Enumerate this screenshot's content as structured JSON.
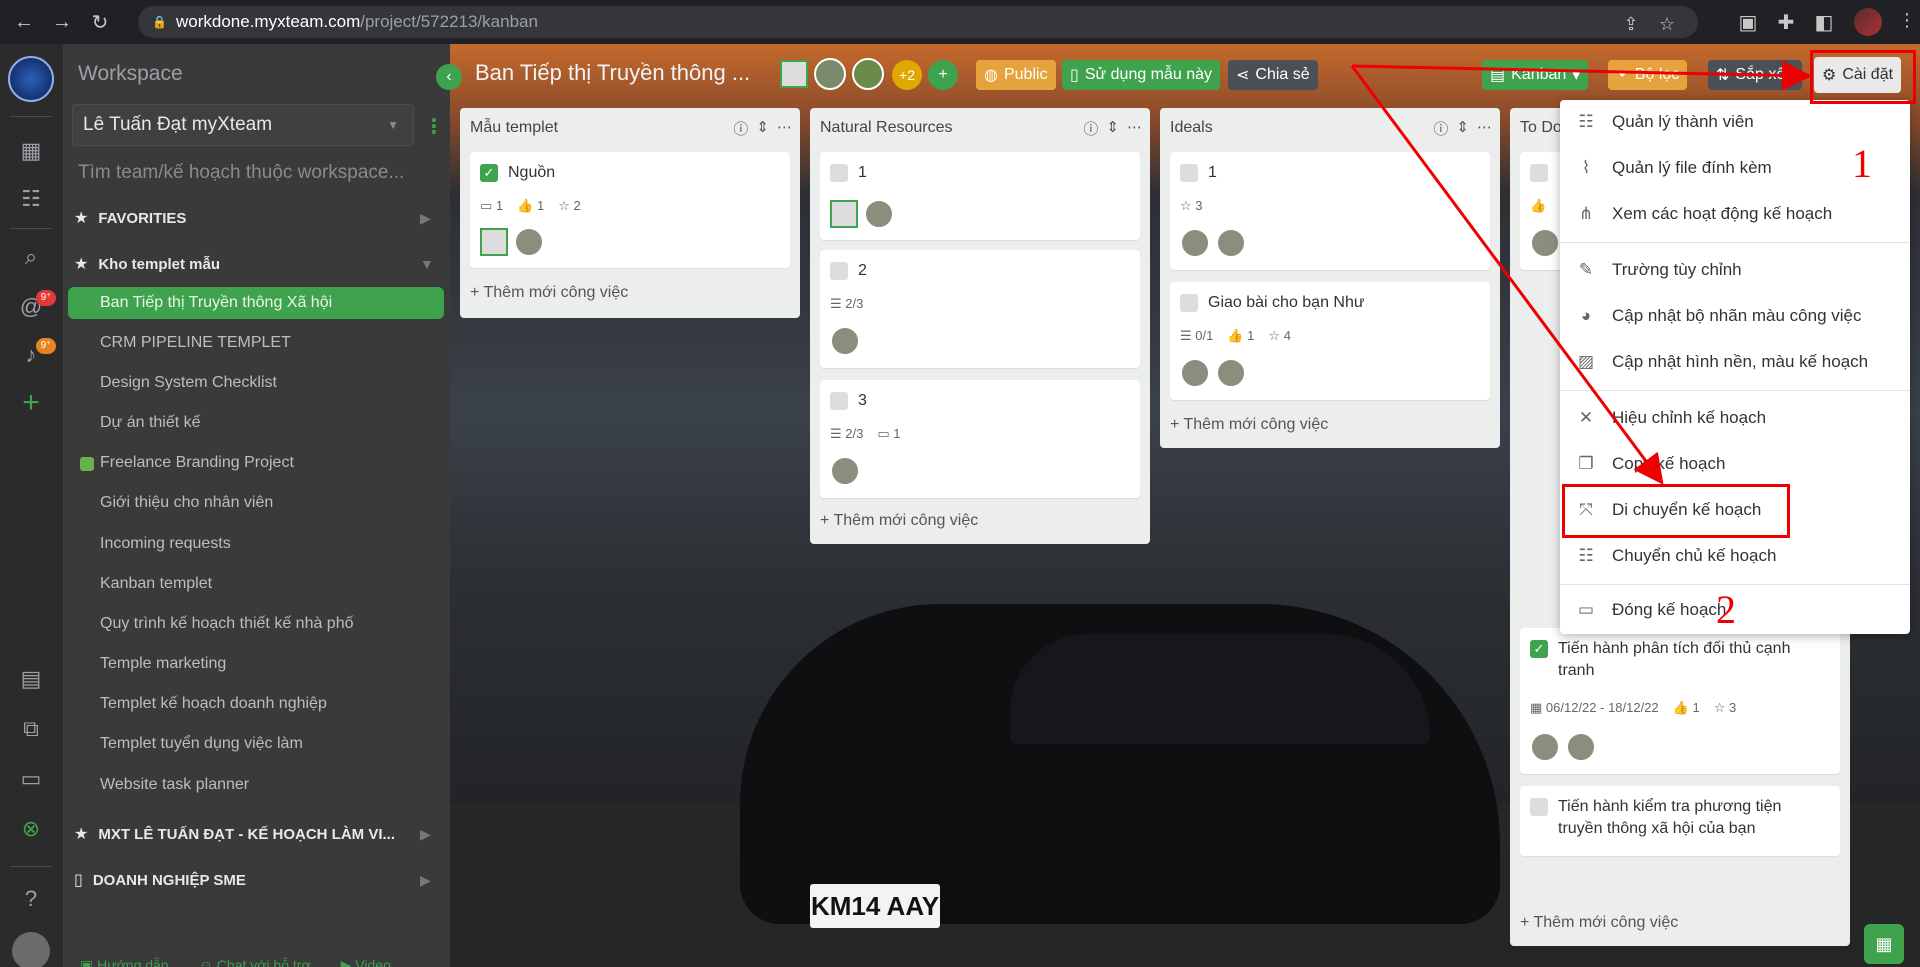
{
  "browser": {
    "url_host": "workdone.myxteam.com",
    "url_path": "/project/572213/kanban"
  },
  "sidebar": {
    "workspace_label": "Workspace",
    "selected_workspace": "Lê Tuấn Đạt myXteam",
    "search_placeholder": "Tìm team/kế hoạch thuộc workspace...",
    "favorites_label": "FAVORITIES",
    "group1_label": "Kho templet mẫu",
    "projects": [
      "Ban Tiếp thị Truyền thông Xã hội",
      "CRM PIPELINE TEMPLET",
      "Design System Checklist",
      "Dự án thiết kế",
      "Freelance Branding Project",
      "Giới thiệu cho nhân viên",
      "Incoming requests",
      "Kanban templet",
      "Quy trình kế hoạch thiết kế nhà phố",
      "Temple marketing",
      "Templet kế hoạch doanh nghiệp",
      "Templet tuyển dụng việc làm",
      "Website task planner"
    ],
    "group2_label": "MXT LÊ TUẤN ĐẠT - KẾ HOẠCH LÀM VI...",
    "group3_label": "DOANH NGHIỆP SME",
    "footer": {
      "guide": "Hướng dẫn",
      "chat": "Chat với hỗ trợ",
      "video": "Video"
    }
  },
  "rail": {
    "mentions_badge": "9⁺",
    "notifications_badge": "9⁺"
  },
  "header": {
    "title": "Ban Tiếp thị Truyền thông ...",
    "extra_members": "+2",
    "public_label": "Public",
    "use_template_label": "Sử dụng mẫu này",
    "share_label": "Chia sẻ",
    "kanban_label": "Kanban",
    "filter_label": "Bộ lọc",
    "sort_label": "Sắp xếp",
    "settings_label": "Cài đặt"
  },
  "columns": [
    {
      "title": "Mẫu templet",
      "add_task": "Thêm mới công việc",
      "cards": [
        {
          "title": "Nguồn",
          "comments": "1",
          "likes": "1",
          "stars": "2"
        }
      ]
    },
    {
      "title": "Natural Resources",
      "add_task": "Thêm mới công việc",
      "cards": [
        {
          "title": "1"
        },
        {
          "title": "2",
          "checklist": "2/3"
        },
        {
          "title": "3",
          "checklist": "2/3",
          "comments": "1"
        }
      ]
    },
    {
      "title": "Ideals",
      "add_task": "Thêm mới công việc",
      "cards": [
        {
          "title": "1",
          "stars": "3"
        },
        {
          "title": "Giao bài cho bạn Như",
          "checklist": "0/1",
          "likes": "1",
          "stars": "4"
        }
      ]
    },
    {
      "title": "To Do",
      "add_task": "Thêm mới công việc",
      "cards": [
        {
          "title": "Tiến hành phân tích đối thủ cạnh tranh",
          "dates": "06/12/22 - 18/12/22",
          "likes": "1",
          "stars": "3"
        },
        {
          "title": "Tiến hành kiểm tra phương tiện truyền thông xã hội của bạn"
        }
      ],
      "partial_likes": "1"
    }
  ],
  "menu": {
    "items": [
      {
        "label": "Quản lý thành viên",
        "icon": "members-icon"
      },
      {
        "label": "Quản lý file đính kèm",
        "icon": "paperclip-icon"
      },
      {
        "label": "Xem các hoạt động kế hoạch",
        "icon": "activity-icon"
      },
      {
        "label": "Trường tùy chỉnh",
        "icon": "edit-field-icon"
      },
      {
        "label": "Cập nhật bộ nhãn màu công việc",
        "icon": "palette-icon"
      },
      {
        "label": "Cập nhật hình nền, màu kế hoạch",
        "icon": "image-icon"
      },
      {
        "label": "Hiệu chỉnh kế hoạch",
        "icon": "tools-icon"
      },
      {
        "label": "Copy kế hoạch",
        "icon": "copy-icon"
      },
      {
        "label": "Di chuyển kế hoạch",
        "icon": "move-icon"
      },
      {
        "label": "Chuyển chủ kế hoạch",
        "icon": "transfer-owner-icon"
      },
      {
        "label": "Đóng kế hoạch",
        "icon": "archive-icon"
      }
    ]
  },
  "annotations": {
    "step1": "1",
    "step2": "2",
    "color": "#e00000"
  },
  "colors": {
    "accent_green": "#3fa34d",
    "accent_orange": "#e6a23c"
  },
  "car_plate": "KM14 AAY"
}
